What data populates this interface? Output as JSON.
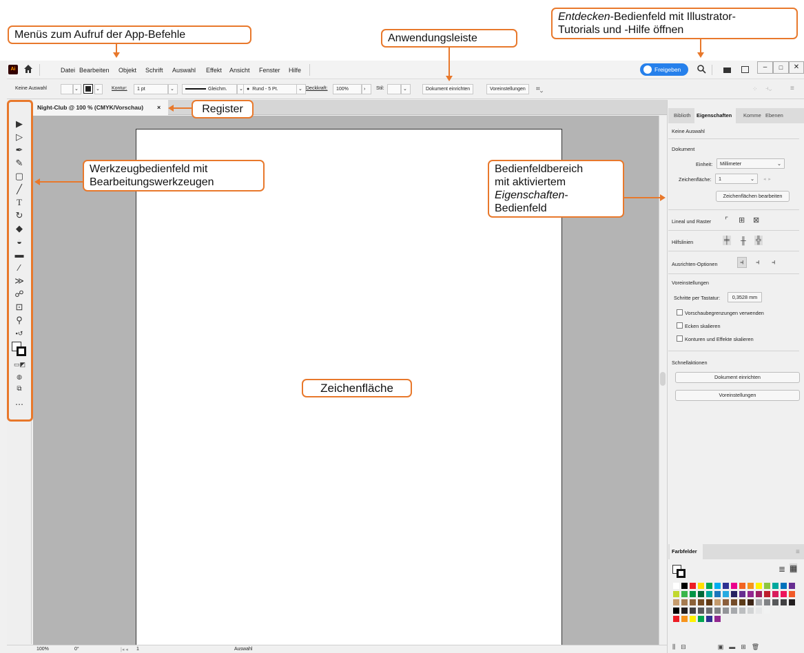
{
  "menubar": {
    "logo": "Ai",
    "items": [
      "Datei",
      "Bearbeiten",
      "Objekt",
      "Schrift",
      "Auswahl",
      "Effekt",
      "Ansicht",
      "Fenster",
      "Hilfe"
    ],
    "share_label": "Freigeben"
  },
  "controlbar": {
    "selection": "Keine Auswahl",
    "stroke_label": "Kontur:",
    "stroke_value": "1 pt",
    "stroke_style": "Gleichm.",
    "brush": "Rund - 5 Pt.",
    "opacity_label": "Deckkraft:",
    "opacity_value": "100%",
    "style_label": "Stil:",
    "doc_setup": "Dokument einrichten",
    "prefs": "Voreinstellungen"
  },
  "document_tab": {
    "title": "Night-Club @ 100 % (CMYK/Vorschau)",
    "close": "×"
  },
  "statusbar": {
    "zoom": "100%",
    "rotation": "0°",
    "artboard": "1",
    "tool": "Auswahl"
  },
  "panel": {
    "tabs": [
      "Biblioth",
      "Eigenschaften",
      "Komme",
      "Ebenen"
    ],
    "no_selection": "Keine Auswahl",
    "document_heading": "Dokument",
    "unit_label": "Einheit:",
    "unit_value": "Millimeter",
    "artboard_label": "Zeichenfläche:",
    "artboard_value": "1",
    "edit_artboards": "Zeichenflächen bearbeiten",
    "rulers_grid": "Lineal und Raster",
    "guides": "Hilfslinien",
    "align_options": "Ausrichten-Optionen",
    "prefs_heading": "Voreinstellungen",
    "keyboard_increment_label": "Schritte per Tastatur:",
    "keyboard_increment_value": "0,3528 mm",
    "checkboxes": [
      "Vorschaubegrenzungen verwenden",
      "Ecken skalieren",
      "Konturen und Effekte skalieren"
    ],
    "quick_actions": "Schnellaktionen",
    "quick_btn1": "Dokument einrichten",
    "quick_btn2": "Voreinstellungen",
    "swatches_tab": "Farbfelder"
  },
  "swatch_colors": {
    "row1": [
      "#ffffff",
      "#000000",
      "#ed1c24",
      "#ffde00",
      "#00a650",
      "#00aeef",
      "#2e3192",
      "#ec008c",
      "#f26522",
      "#f7941d",
      "#fff200",
      "#8dc63f",
      "#00a99d",
      "#0072bc",
      "#662d91"
    ],
    "row2": [
      "#c1d82f",
      "#39b54a",
      "#009444",
      "#006838",
      "#00a79d",
      "#1b75bc",
      "#27aae1",
      "#262262",
      "#662d91",
      "#92278f",
      "#9e1f63",
      "#be1e2d",
      "#d91c5c",
      "#ed145b",
      "#f15a29"
    ],
    "row3": [
      "#c69c6d",
      "#a67c52",
      "#8c6239",
      "#754c24",
      "#603913",
      "#c49a6c",
      "#8b5e3c",
      "#754c29",
      "#5c3b18",
      "#3c2415",
      "#a7a9ac",
      "#808285",
      "#58595b",
      "#414042",
      "#231f20"
    ],
    "row4": [
      "#000000",
      "#231f20",
      "#414042",
      "#58595b",
      "#6d6e71",
      "#808285",
      "#939598",
      "#a7a9ac",
      "#bcbec0",
      "#d1d3d4",
      "#e6e7e8",
      "#f1f2f2"
    ],
    "row5": [
      "#ed1c24",
      "#f7941d",
      "#fff200",
      "#00a650",
      "#2e3192",
      "#92278f"
    ]
  },
  "annotations": {
    "menus": "Menüs zum Aufruf der App-Befehle",
    "appbar": "Anwendungsleiste",
    "discover_em": "Entdecken",
    "discover_rest1": "-Bedienfeld mit Illustrator-",
    "discover_rest2": "Tutorials und -Hilfe öffnen",
    "register": "Register",
    "toolbar1": "Werkzeugbedienfeld mit",
    "toolbar2": "Bearbeitungswerkzeugen",
    "panel1": "Bedienfeldbereich",
    "panel2": "mit aktiviertem",
    "panel3_em": "Eigenschaften",
    "panel3_rest": "-",
    "panel4": "Bedienfeld",
    "artboard": "Zeichenfläche"
  },
  "colors": {
    "accent": "#e8782b",
    "share_button": "#2680eb",
    "logo": "#330000"
  }
}
